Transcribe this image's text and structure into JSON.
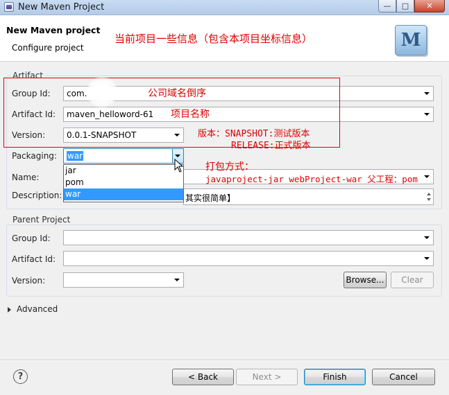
{
  "window": {
    "title": "New Maven Project"
  },
  "header": {
    "title": "New Maven project",
    "subtitle": "Configure project",
    "logo_letter": "M"
  },
  "artifact": {
    "group_label": "Artifact",
    "group_id_label": "Group Id:",
    "group_id_value": "com.",
    "artifact_id_label": "Artifact Id:",
    "artifact_id_value": "maven_helloword-61",
    "version_label": "Version:",
    "version_value": "0.0.1-SNAPSHOT",
    "packaging_label": "Packaging:",
    "packaging_value": "war",
    "packaging_options": [
      "jar",
      "pom",
      "war"
    ],
    "name_label": "Name:",
    "description_label": "Description:",
    "description_value": "其实很简单】"
  },
  "parent": {
    "group_label": "Parent Project",
    "group_id_label": "Group Id:",
    "artifact_id_label": "Artifact Id:",
    "version_label": "Version:",
    "browse_label": "Browse...",
    "clear_label": "Clear"
  },
  "advanced": {
    "label": "Advanced"
  },
  "footer": {
    "help_glyph": "?",
    "back_label": "< Back",
    "next_label": "Next >",
    "finish_label": "Finish",
    "cancel_label": "Cancel"
  },
  "annotations": {
    "header_note": "当前项目一些信息（包含本项目坐标信息）",
    "group_note": "公司域名倒序",
    "artifact_note": "项目名称",
    "version_note_1": "版本：SNAPSHOT:测试版本",
    "version_note_2": "RELEASE:正式版本",
    "packaging_note_1": "打包方式：",
    "packaging_note_2": "javaproject-jar  webProject-war 父工程：pom"
  },
  "colors": {
    "annotation": "#e00000",
    "selection": "#3399ff"
  }
}
